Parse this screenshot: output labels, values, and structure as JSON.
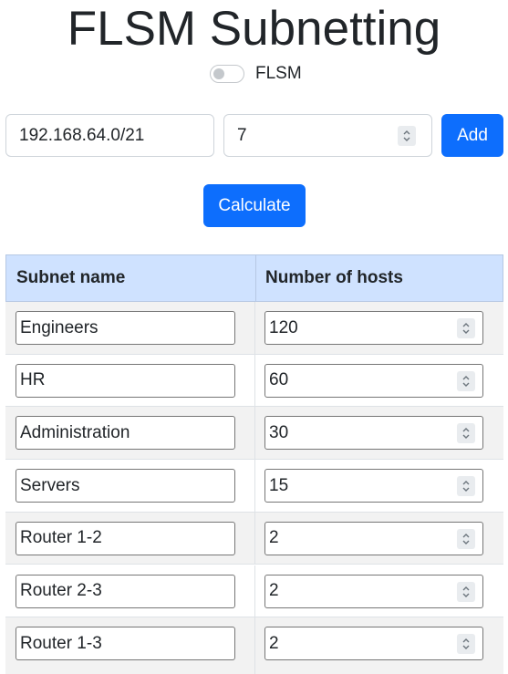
{
  "title": "FLSM Subnetting",
  "mode_toggle": {
    "label": "FLSM",
    "checked": false
  },
  "network_input": {
    "value": "192.168.64.0/21"
  },
  "count_input": {
    "value": "7"
  },
  "add_button": {
    "label": "Add"
  },
  "calculate_button": {
    "label": "Calculate"
  },
  "table": {
    "headers": [
      "Subnet name",
      "Number of hosts"
    ],
    "rows": [
      {
        "name": "Engineers",
        "hosts": "120"
      },
      {
        "name": "HR",
        "hosts": "60"
      },
      {
        "name": "Administration",
        "hosts": "30"
      },
      {
        "name": "Servers",
        "hosts": "15"
      },
      {
        "name": "Router 1-2",
        "hosts": "2"
      },
      {
        "name": "Router 2-3",
        "hosts": "2"
      },
      {
        "name": "Router 1-3",
        "hosts": "2"
      }
    ]
  },
  "colors": {
    "primary": "#0d6efd",
    "header_bg": "#cfe2ff",
    "striped_row": "#f2f2f2"
  },
  "icons": {
    "spinner": "up-down-chevron-icon"
  }
}
